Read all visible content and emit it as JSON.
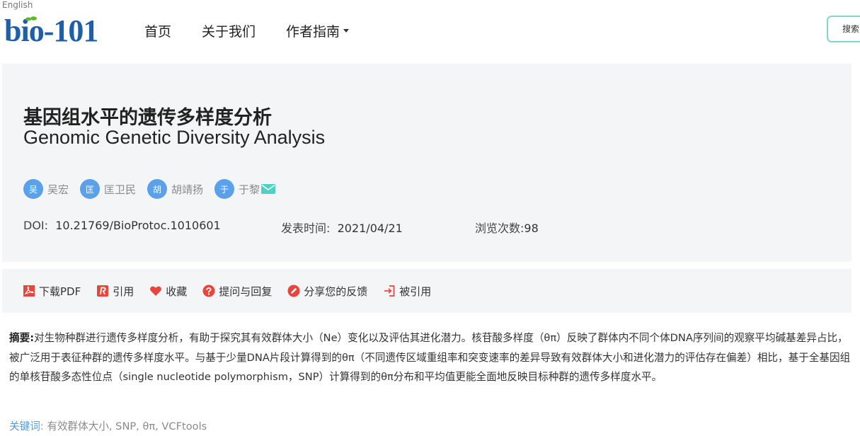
{
  "header": {
    "language_link": "English",
    "logo_text": "bio-101",
    "nav": [
      {
        "label": "首页"
      },
      {
        "label": "关于我们"
      },
      {
        "label": "作者指南"
      }
    ],
    "search_label": "搜索"
  },
  "article": {
    "title_cn": "基因组水平的遗传多样度分析",
    "title_en": "Genomic Genetic Diversity Analysis",
    "authors": [
      {
        "initial": "吴",
        "name": "吴宏"
      },
      {
        "initial": "匡",
        "name": "匡卫民"
      },
      {
        "initial": "胡",
        "name": "胡靖扬"
      },
      {
        "initial": "于",
        "name": "于黎",
        "has_mail": true
      }
    ],
    "doi_label": "DOI:",
    "doi": "10.21769/BioProtoc.1010601",
    "date_label": "发表时间:",
    "date": "2021/04/21",
    "views_label": "浏览次数:",
    "views": "98"
  },
  "toolbar": [
    {
      "label": "下载PDF",
      "icon": "pdf-icon"
    },
    {
      "label": "引用",
      "icon": "cite-icon"
    },
    {
      "label": "收藏",
      "icon": "heart-icon"
    },
    {
      "label": "提问与回复",
      "icon": "question-icon"
    },
    {
      "label": "分享您的反馈",
      "icon": "feedback-icon"
    },
    {
      "label": "被引用",
      "icon": "cited-by-icon"
    }
  ],
  "abstract": {
    "label": "摘要:",
    "text": "对生物种群进行遗传多样度分析，有助于探究其有效群体大小（Ne）变化以及评估其进化潜力。核苷酸多样度（θπ）反映了群体内不同个体DNA序列间的观察平均碱基差异占比，被广泛用于表征种群的遗传多样度水平。与基于少量DNA片段计算得到的θπ（不同遗传区域重组率和突变速率的差异导致有效群体大小和进化潜力的评估存在偏差）相比，基于全基因组的单核苷酸多态性位点（single nucleotide polymorphism，SNP）计算得到的θπ分布和平均值更能全面地反映目标种群的遗传多样度水平。"
  },
  "keywords": {
    "label": "关键词:",
    "text": "有效群体大小, SNP, θπ, VCFtools"
  },
  "colors": {
    "brand": "#1f5fa8",
    "accent_red": "#e8453c",
    "avatar_blue": "#5aa0ea",
    "search_border": "#7fd6cf",
    "mail_teal": "#4fd1c5"
  }
}
